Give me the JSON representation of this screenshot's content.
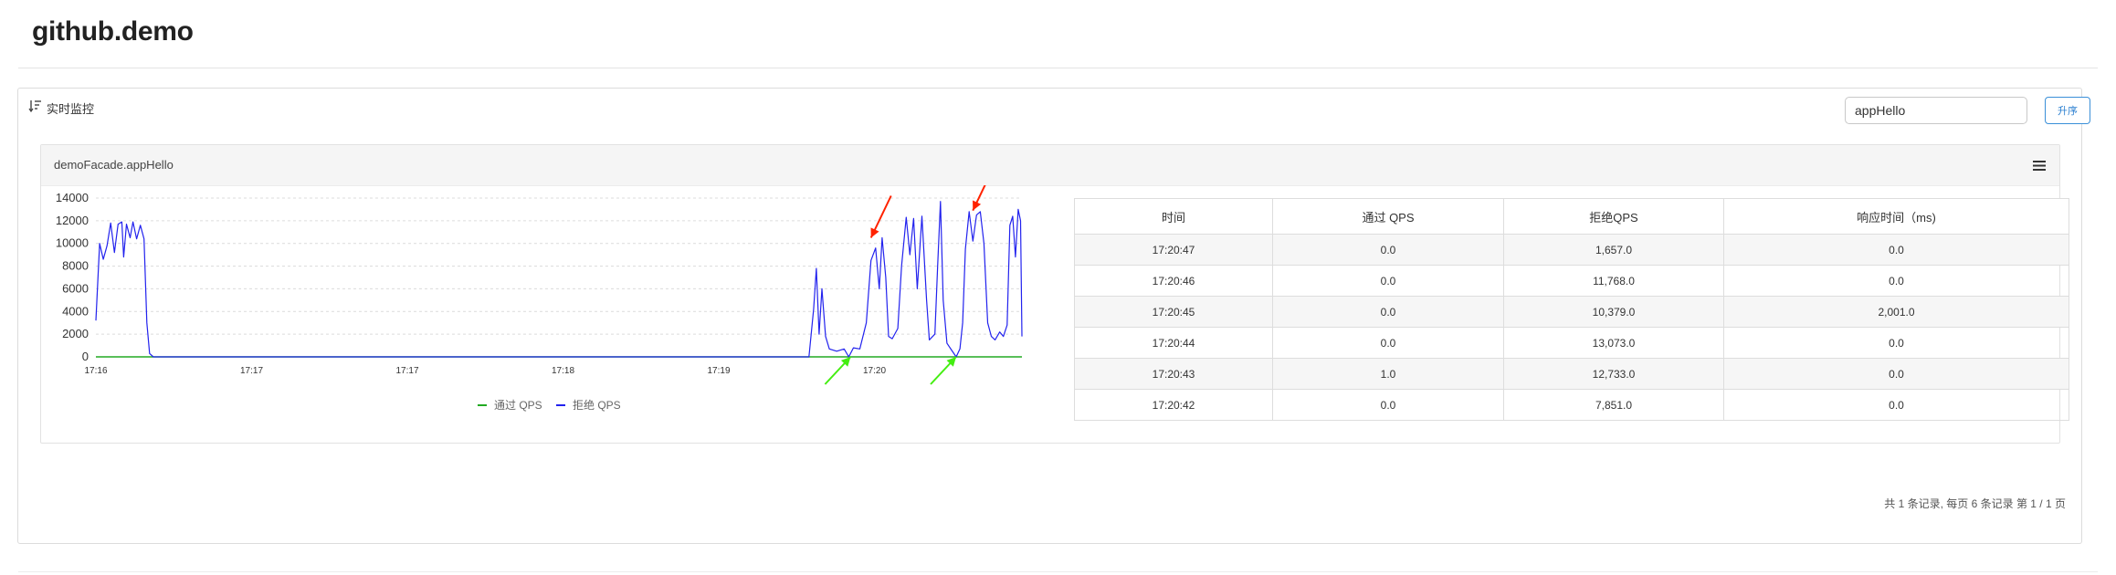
{
  "app": {
    "title": "github.demo"
  },
  "panel": {
    "header_label": "实时监控",
    "header_icon": "sort-lines-icon",
    "search": {
      "value": "appHello",
      "placeholder": ""
    },
    "sort_button_label": "升序"
  },
  "card": {
    "title": "demoFacade.appHello",
    "menu_icon": "hamburger-menu-icon"
  },
  "chart_data": {
    "type": "line",
    "x": [
      "17:16",
      "17:17",
      "17:17",
      "17:18",
      "17:19",
      "17:20"
    ],
    "ylim": [
      0,
      14000
    ],
    "yticks": [
      0,
      2000,
      4000,
      6000,
      8000,
      10000,
      12000,
      14000
    ],
    "grid": true,
    "legend": "bottom-center",
    "series": [
      {
        "name": "通过 QPS",
        "color": "#22aa22",
        "values": [
          [
            0,
            0
          ],
          [
            100,
            0
          ]
        ]
      },
      {
        "name": "拒绝 QPS",
        "color": "#2222ee",
        "values": [
          [
            0,
            3200
          ],
          [
            0.4,
            10000
          ],
          [
            0.8,
            8600
          ],
          [
            1.2,
            9800
          ],
          [
            1.6,
            11800
          ],
          [
            2.0,
            9200
          ],
          [
            2.4,
            11700
          ],
          [
            2.8,
            11900
          ],
          [
            3.0,
            8800
          ],
          [
            3.3,
            11700
          ],
          [
            3.7,
            10500
          ],
          [
            4.0,
            11900
          ],
          [
            4.4,
            10400
          ],
          [
            4.8,
            11600
          ],
          [
            5.2,
            10400
          ],
          [
            5.5,
            3000
          ],
          [
            5.8,
            300
          ],
          [
            6.2,
            0
          ],
          [
            77,
            0
          ],
          [
            77.5,
            4200
          ],
          [
            77.8,
            7800
          ],
          [
            78.1,
            2000
          ],
          [
            78.4,
            6000
          ],
          [
            78.8,
            1800
          ],
          [
            79.2,
            700
          ],
          [
            80,
            500
          ],
          [
            80.8,
            700
          ],
          [
            81.3,
            0
          ],
          [
            81.8,
            800
          ],
          [
            82.5,
            700
          ],
          [
            83.2,
            3000
          ],
          [
            83.7,
            8500
          ],
          [
            84.2,
            9600
          ],
          [
            84.6,
            6000
          ],
          [
            84.9,
            10500
          ],
          [
            85.3,
            7000
          ],
          [
            85.6,
            1800
          ],
          [
            86.0,
            1600
          ],
          [
            86.6,
            2500
          ],
          [
            87.0,
            8000
          ],
          [
            87.5,
            12300
          ],
          [
            87.9,
            9000
          ],
          [
            88.3,
            12200
          ],
          [
            88.7,
            6000
          ],
          [
            89.2,
            12400
          ],
          [
            89.7,
            5000
          ],
          [
            90.0,
            1500
          ],
          [
            90.6,
            2000
          ],
          [
            90.9,
            8000
          ],
          [
            91.2,
            13700
          ],
          [
            91.5,
            5000
          ],
          [
            91.9,
            1200
          ],
          [
            92.4,
            600
          ],
          [
            92.9,
            0
          ],
          [
            93.3,
            700
          ],
          [
            93.6,
            3000
          ],
          [
            93.9,
            9500
          ],
          [
            94.3,
            12800
          ],
          [
            94.7,
            10200
          ],
          [
            95.1,
            12500
          ],
          [
            95.5,
            12800
          ],
          [
            95.9,
            10000
          ],
          [
            96.3,
            3000
          ],
          [
            96.7,
            1800
          ],
          [
            97.1,
            1500
          ],
          [
            97.6,
            2200
          ],
          [
            98.0,
            1800
          ],
          [
            98.4,
            2800
          ],
          [
            98.7,
            11600
          ],
          [
            99.0,
            12400
          ],
          [
            99.3,
            8800
          ],
          [
            99.6,
            13000
          ],
          [
            99.85,
            12000
          ],
          [
            100,
            1800
          ]
        ]
      }
    ],
    "annotations": [
      {
        "kind": "arrow",
        "color": "#ff2200",
        "target_x": 83.7,
        "target_y": 10500
      },
      {
        "kind": "arrow",
        "color": "#ff2200",
        "target_x": 94.7,
        "target_y": 12900
      },
      {
        "kind": "arrow",
        "color": "#44ee11",
        "target_x": 81.5,
        "target_y": 0
      },
      {
        "kind": "arrow",
        "color": "#44ee11",
        "target_x": 92.9,
        "target_y": 0
      }
    ]
  },
  "table": {
    "headers": [
      "时间",
      "通过 QPS",
      "拒绝QPS",
      "响应时间（ms)"
    ],
    "rows": [
      [
        "17:20:47",
        "0.0",
        "1,657.0",
        "0.0"
      ],
      [
        "17:20:46",
        "0.0",
        "11,768.0",
        "0.0"
      ],
      [
        "17:20:45",
        "0.0",
        "10,379.0",
        "2,001.0"
      ],
      [
        "17:20:44",
        "0.0",
        "13,073.0",
        "0.0"
      ],
      [
        "17:20:43",
        "1.0",
        "12,733.0",
        "0.0"
      ],
      [
        "17:20:42",
        "0.0",
        "7,851.0",
        "0.0"
      ]
    ]
  },
  "pagination": {
    "text": "共 1 条记录, 每页 6 条记录 第 1 / 1 页"
  }
}
